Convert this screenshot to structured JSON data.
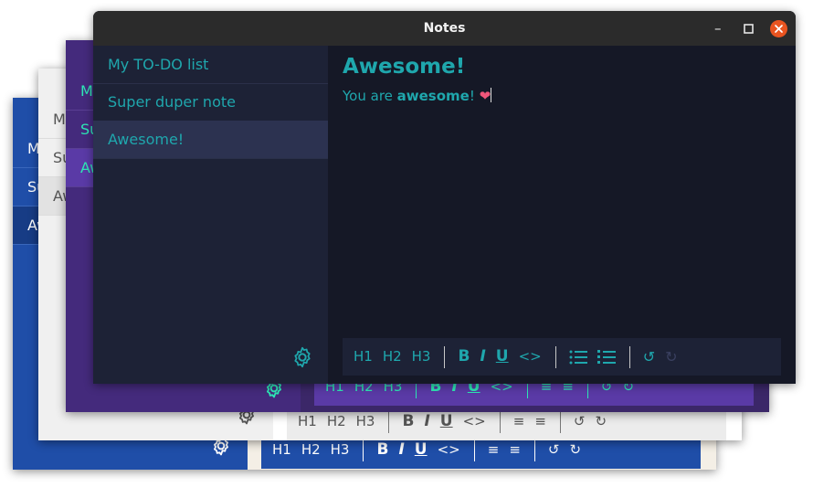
{
  "window": {
    "title": "Notes",
    "controls": {
      "minimize": "–",
      "maximize": "□",
      "close": "✕"
    }
  },
  "notes": [
    {
      "title": "My TO-DO list"
    },
    {
      "title": "Super duper note"
    },
    {
      "title": "Awesome!"
    }
  ],
  "back_windows": {
    "blue": {
      "items": [
        "M",
        "Su",
        "Aw"
      ]
    },
    "light": {
      "items": [
        "M",
        "Su",
        "Aw"
      ]
    },
    "purple": {
      "items": [
        "M",
        "Su",
        "Aw"
      ]
    }
  },
  "editor": {
    "heading": "Awesome!",
    "body_prefix": "You are ",
    "body_bold": "awesome",
    "body_suffix": "! ",
    "emoji": "❤"
  },
  "toolbar": {
    "h1": "H1",
    "h2": "H2",
    "h3": "H3",
    "bold": "B",
    "italic": "I",
    "underline": "U",
    "code": "<>",
    "undo": "↺",
    "redo": "↻"
  },
  "themes": {
    "main_accent": "#1fa7ad",
    "purple_accent": "#2ee8b6",
    "blue_bg": "#1f4ea8"
  },
  "icons": [
    "gear-icon",
    "bullet-list-icon",
    "numbered-list-icon",
    "undo-icon",
    "redo-icon",
    "close-icon",
    "maximize-icon",
    "minimize-icon"
  ]
}
